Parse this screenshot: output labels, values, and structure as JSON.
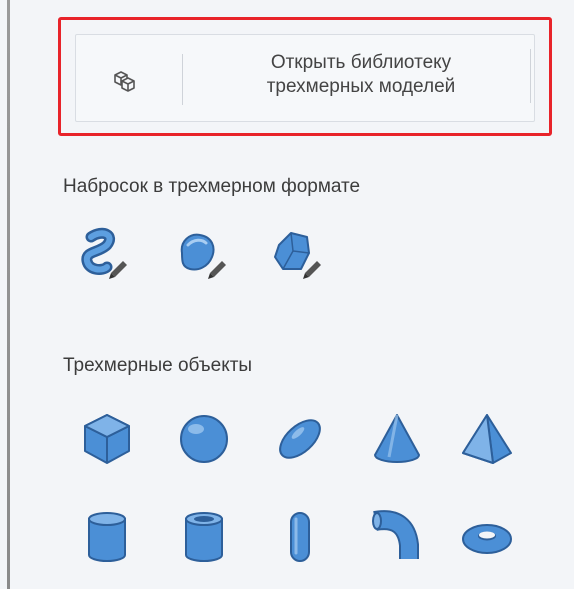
{
  "toolbar": {
    "open_library_label": "Открыть библиотеку\nтрехмерных моделей",
    "open_library_icon": "3d-library-icon"
  },
  "sketch_section": {
    "title": "Набросок в трехмерном формате",
    "tools": [
      {
        "icon": "3d-tube-sketch-icon"
      },
      {
        "icon": "3d-soft-edge-sketch-icon"
      },
      {
        "icon": "3d-sharp-edge-sketch-icon"
      }
    ]
  },
  "objects_section": {
    "title": "Трехмерные объекты",
    "shapes": [
      {
        "icon": "cube-icon"
      },
      {
        "icon": "sphere-icon"
      },
      {
        "icon": "ellipsoid-icon"
      },
      {
        "icon": "cone-icon"
      },
      {
        "icon": "pyramid-icon"
      },
      {
        "icon": "cylinder-icon"
      },
      {
        "icon": "tube-icon"
      },
      {
        "icon": "capsule-icon"
      },
      {
        "icon": "elbow-pipe-icon"
      },
      {
        "icon": "torus-icon"
      }
    ]
  },
  "colors": {
    "highlight_border": "#e8232a",
    "shape_fill": "#4b8fd6",
    "shape_stroke": "#2d5f9a"
  }
}
